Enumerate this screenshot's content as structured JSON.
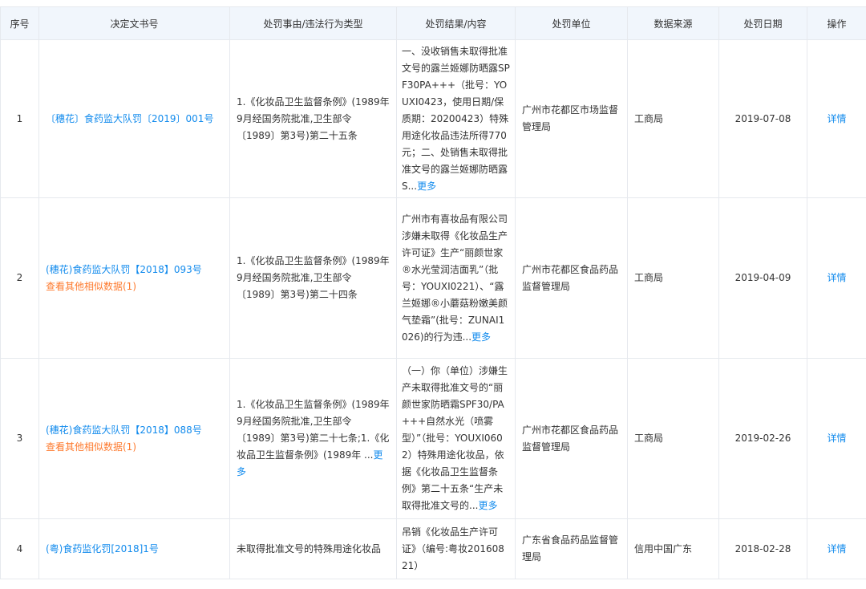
{
  "table": {
    "headers": [
      "序号",
      "决定文书号",
      "处罚事由/违法行为类型",
      "处罚结果/内容",
      "处罚单位",
      "数据来源",
      "处罚日期",
      "操作"
    ],
    "more_label": "更多",
    "detail_label": "详情",
    "rows": [
      {
        "index": "1",
        "doc_no": "〔穗花〕食药监大队罚〔2019〕001号",
        "similar": "",
        "reason": "1.《化妆品卫生监督条例》(1989年9月经国务院批准,卫生部令〔1989〕第3号)第二十五条",
        "reason_more": "",
        "result": "一、没收销售未取得批准文号的露兰姬娜防晒露SPF30PA+++（批号：YOUXI0423，使用日期/保质期：20200423）特殊用途化妆品违法所得770元；二、处销售未取得批准文号的露兰姬娜防晒露S...",
        "result_more": "更多",
        "unit": "广州市花都区市场监督管理局",
        "source": "工商局",
        "date": "2019-07-08",
        "action": "详情"
      },
      {
        "index": "2",
        "doc_no": "(穗花)食药监大队罚【2018】093号",
        "similar": "查看其他相似数据(1)",
        "reason": "1.《化妆品卫生监督条例》(1989年9月经国务院批准,卫生部令〔1989〕第3号)第二十四条",
        "reason_more": "",
        "result": "广州市有喜妆品有限公司涉嫌未取得《化妆品生产许可证》生产“丽颜世家®水光莹润洁面乳”（批号：YOUXI0221）、“露兰姬娜®小蘑菇粉嫩美颜气垫霜”(批号：ZUNAI1026)的行为违...",
        "result_more": "更多",
        "unit": "广州市花都区食品药品监督管理局",
        "source": "工商局",
        "date": "2019-04-09",
        "action": "详情"
      },
      {
        "index": "3",
        "doc_no": "(穗花)食药监大队罚【2018】088号",
        "similar": "查看其他相似数据(1)",
        "reason": "1.《化妆品卫生监督条例》(1989年9月经国务院批准,卫生部令〔1989〕第3号)第二十七条;1.《化妆品卫生监督条例》(1989年 ...",
        "reason_more": "更多",
        "result": "（一）你（单位）涉嫌生产未取得批准文号的“丽颜世家防晒霜SPF30/PA+++自然水光（喷雾型）”（批号：YOUXI0602）特殊用途化妆品，依据《化妆品卫生监督条例》第二十五条“生产未取得批准文号的...",
        "result_more": "更多",
        "unit": "广州市花都区食品药品监督管理局",
        "source": "工商局",
        "date": "2019-02-26",
        "action": "详情"
      },
      {
        "index": "4",
        "doc_no": "(粤)食药监化罚[2018]1号",
        "similar": "",
        "reason": "未取得批准文号的特殊用途化妆品",
        "reason_more": "",
        "result": "吊销《化妆品生产许可证》（编号:粤妆20160821）",
        "result_more": "",
        "unit": "广东省食品药品监督管理局",
        "source": "信用中国广东",
        "date": "2018-02-28",
        "action": "详情"
      }
    ]
  }
}
